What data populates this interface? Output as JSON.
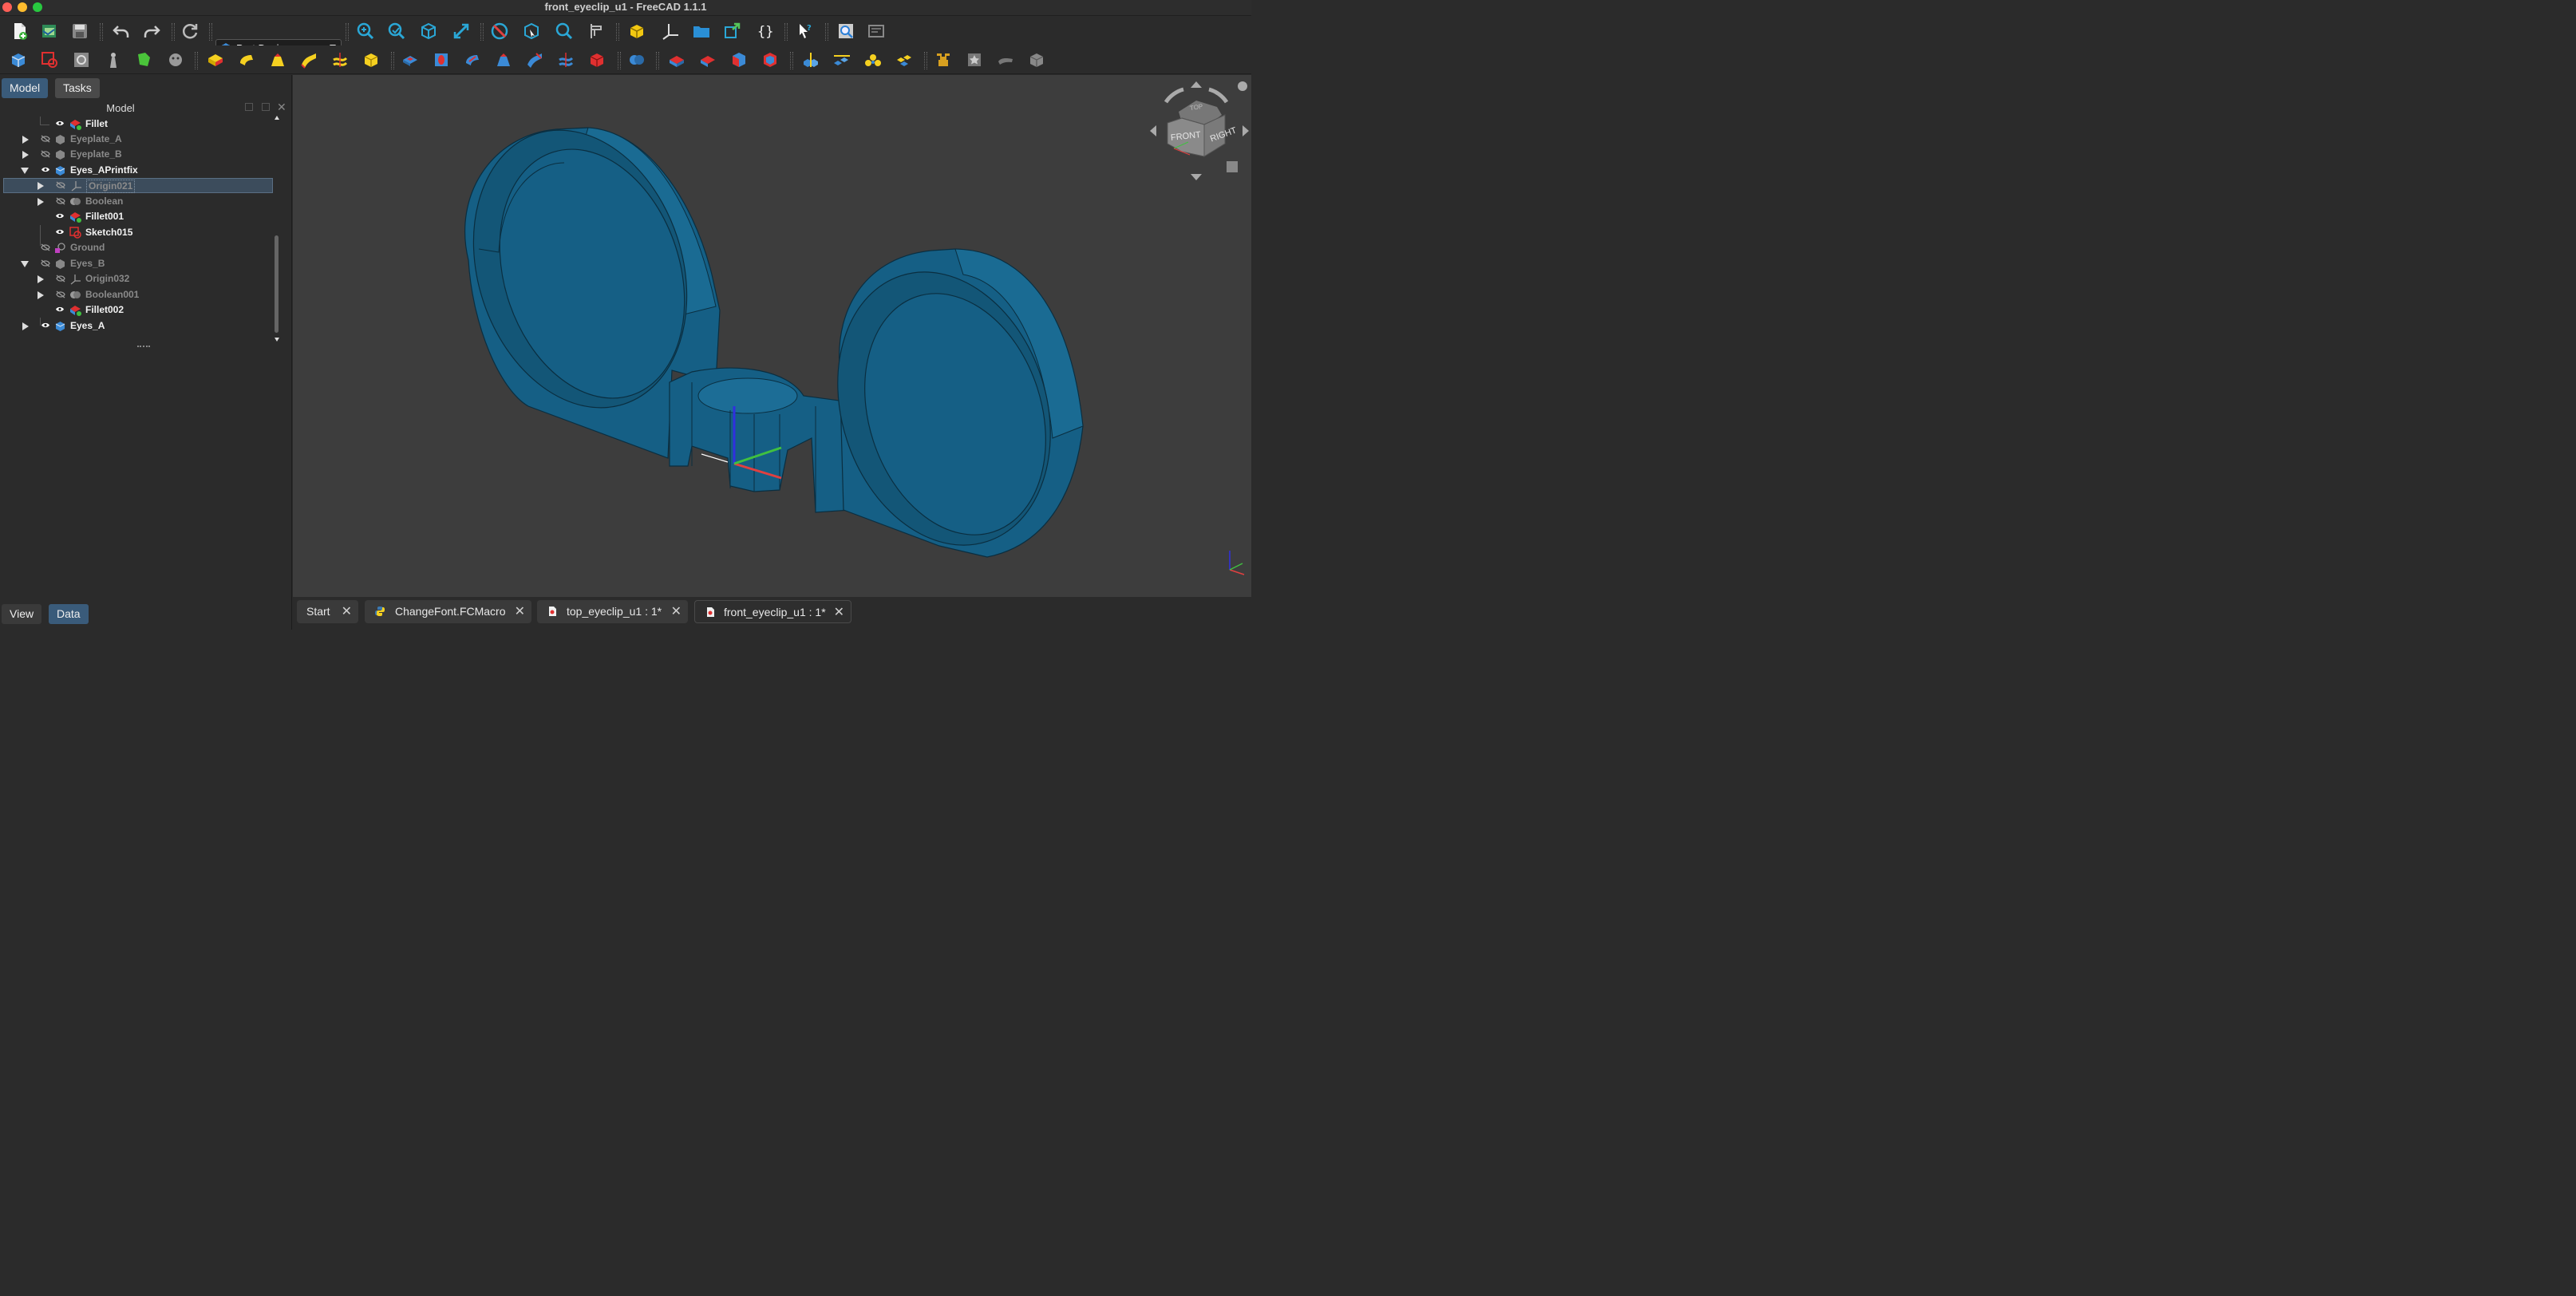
{
  "window": {
    "title": "front_eyeclip_u1 - FreeCAD 1.1.1"
  },
  "workbench": {
    "selected": "Part Design"
  },
  "left_panel": {
    "tabs": [
      "Model",
      "Tasks"
    ],
    "active_tab": "Model",
    "title": "Model",
    "bottom_tabs": [
      "View",
      "Data"
    ],
    "active_bottom_tab": "Data",
    "tree": [
      {
        "label": "Fillet",
        "visible": true
      },
      {
        "label": "Eyeplate_A",
        "visible": false,
        "expanded": false
      },
      {
        "label": "Eyeplate_B",
        "visible": false,
        "expanded": false
      },
      {
        "label": "Eyes_APrintfix",
        "visible": true,
        "expanded": true
      },
      {
        "label": "Origin021",
        "visible": false,
        "expanded": false,
        "selected": true
      },
      {
        "label": "Boolean",
        "visible": false,
        "expanded": false
      },
      {
        "label": "Fillet001",
        "visible": true
      },
      {
        "label": "Sketch015",
        "visible": true
      },
      {
        "label": "Ground",
        "visible": false
      },
      {
        "label": "Eyes_B",
        "visible": false,
        "expanded": true
      },
      {
        "label": "Origin032",
        "visible": false,
        "expanded": false
      },
      {
        "label": "Boolean001",
        "visible": false,
        "expanded": false
      },
      {
        "label": "Fillet002",
        "visible": true
      },
      {
        "label": "Eyes_A",
        "visible": true,
        "expanded": false
      }
    ]
  },
  "navcube": {
    "front": "FRONT",
    "right": "RIGHT",
    "top": "TOP"
  },
  "doc_tabs": [
    {
      "label": "Start",
      "icon": "none"
    },
    {
      "label": "ChangeFont.FCMacro",
      "icon": "python-icon"
    },
    {
      "label": "top_eyeclip_u1 : 1*",
      "icon": "document-icon"
    },
    {
      "label": "front_eyeclip_u1 : 1*",
      "icon": "document-icon",
      "active": true
    }
  ],
  "colors": {
    "model_fill": "#155f85",
    "viewport_bg": "#3d3d3d",
    "accent": "#4a90d9"
  }
}
